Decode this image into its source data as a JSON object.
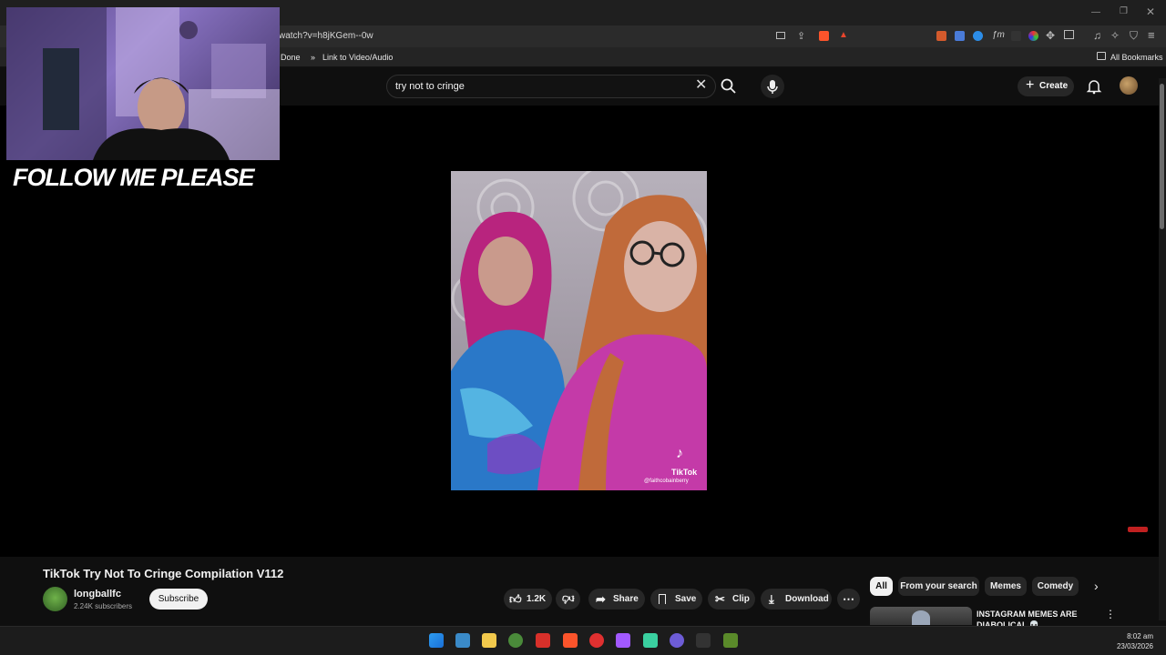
{
  "browser": {
    "url": "watch?v=h8jKGem--0w",
    "bookmarks": [
      "Done",
      "Link to Video/Audio"
    ],
    "all_bookmarks": "All Bookmarks"
  },
  "youtube": {
    "search_value": "try not to cringe",
    "create_label": "Create"
  },
  "overlay": {
    "follow_text": "FOLLOW ME PLEASE"
  },
  "video": {
    "watermark_brand": "TikTok",
    "watermark_handle": "@faithcobainberry",
    "title": "TikTok Try Not To Cringe Compilation V112",
    "channel": "longballfc",
    "subscribers": "2.24K subscribers",
    "subscribe_label": "Subscribe",
    "likes": "1.2K",
    "share_label": "Share",
    "save_label": "Save",
    "clip_label": "Clip",
    "download_label": "Download"
  },
  "chips": [
    "All",
    "From your search",
    "Memes",
    "Comedy"
  ],
  "related": {
    "first_title": "INSTAGRAM MEMES ARE DIABOLICAL 💀"
  },
  "taskbar": {
    "time": "8:02 am",
    "date": "23/03/2026"
  },
  "colors": {
    "accent": "#3ea6ff",
    "background": "#0f0f0f",
    "pill": "#272727"
  }
}
